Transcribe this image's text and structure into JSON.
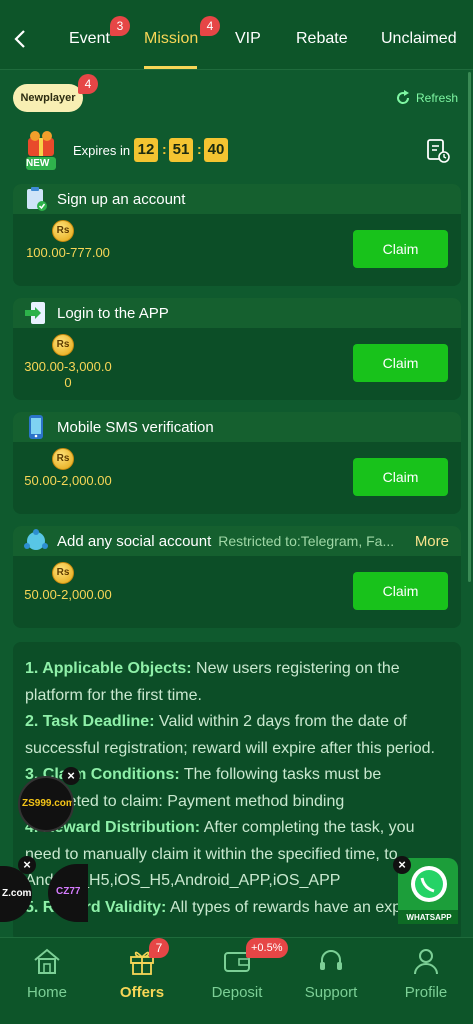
{
  "tabs": [
    {
      "label": "Event",
      "badge": "3"
    },
    {
      "label": "Mission",
      "badge": "4",
      "active": true
    },
    {
      "label": "VIP"
    },
    {
      "label": "Rebate"
    },
    {
      "label": "Unclaimed"
    }
  ],
  "filter": {
    "label": "Newplayer",
    "badge": "4"
  },
  "refresh_label": "Refresh",
  "gift_tag": "NEW",
  "expires": {
    "label": "Expires in",
    "hh": "12",
    "mm": "51",
    "ss": "40"
  },
  "coin_symbol": "Rs",
  "tasks": [
    {
      "title": "Sign up an account",
      "reward": "100.00-777.00",
      "claim": "Claim"
    },
    {
      "title": "Login to the APP",
      "reward": "300.00-3,000.00",
      "claim": "Claim"
    },
    {
      "title": "Mobile SMS verification",
      "reward": "50.00-2,000.00",
      "claim": "Claim"
    },
    {
      "title": "Add any social account",
      "restricted": "Restricted to:Telegram, Fa...",
      "more": "More",
      "reward": "50.00-2,000.00",
      "claim": "Claim"
    }
  ],
  "rules": [
    {
      "head": "1. Applicable Objects:",
      "text": " New users registering on the platform for the first time."
    },
    {
      "head": "2. Task Deadline:",
      "text": " Valid within 2 days from the date of successful registration; reward will expire after this period."
    },
    {
      "head": "3. Claim Conditions:",
      "text": " The following tasks must be completed to claim: Payment method binding"
    },
    {
      "head": "4. Reward Distribution:",
      "text": " After completing the task, you need to manually claim it within the specified time, to Android_H5,iOS_H5,Android_APP,iOS_APP"
    },
    {
      "head": "5. Reward Validity:",
      "text": " All types of rewards have an expiration"
    }
  ],
  "floats": {
    "a": "ZS999.com",
    "b": "Z.com",
    "c": "CZ77",
    "wa": "WHATSAPP"
  },
  "nav": [
    {
      "label": "Home",
      "icon": "home-icon"
    },
    {
      "label": "Offers",
      "icon": "gift-icon",
      "badge": "7",
      "active": true
    },
    {
      "label": "Deposit",
      "icon": "wallet-icon",
      "badge": "+0.5%"
    },
    {
      "label": "Support",
      "icon": "headset-icon"
    },
    {
      "label": "Profile",
      "icon": "user-icon"
    }
  ],
  "colors": {
    "bg": "#0f5a2e",
    "accent": "#f7d657",
    "claim": "#18c21b",
    "badge": "#e64646"
  }
}
